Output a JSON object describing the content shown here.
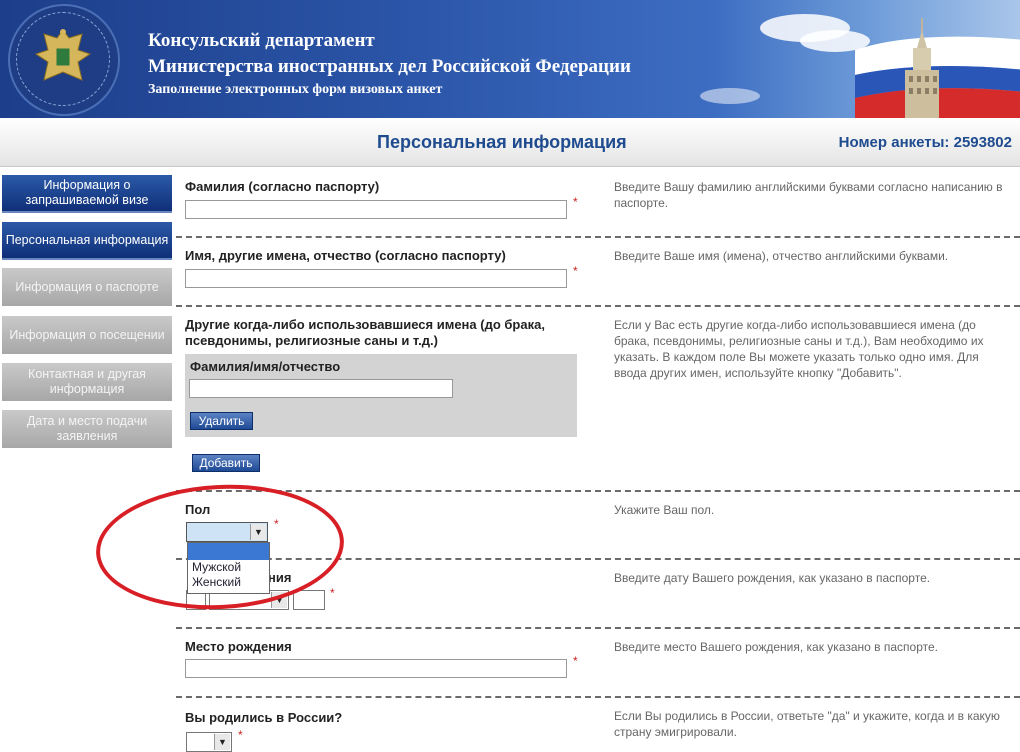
{
  "banner": {
    "title_line1": "Консульский департамент",
    "title_line2": "Министерства иностранных дел Российской Федерации",
    "subtitle": "Заполнение электронных форм визовых анкет"
  },
  "header": {
    "page_title": "Персональная информация",
    "anketa_number": "Номер анкеты: 2593802"
  },
  "nav": {
    "items": [
      {
        "label": "Информация о запрашиваемой визе",
        "state": "active"
      },
      {
        "label": "Персональная информация",
        "state": "active"
      },
      {
        "label": "Информация о паспорте",
        "state": "inactive"
      },
      {
        "label": "Информация о посещении",
        "state": "inactive"
      },
      {
        "label": "Контактная и другая информация",
        "state": "inactive"
      },
      {
        "label": "Дата и место подачи заявления",
        "state": "inactive"
      }
    ]
  },
  "form": {
    "surname": {
      "label": "Фамилия (согласно паспорту)",
      "value": "",
      "help": "Введите Вашу фамилию английскими буквами согласно написанию в паспорте."
    },
    "given_names": {
      "label": "Имя, другие имена, отчество (согласно паспорту)",
      "value": "",
      "help": "Введите Ваше имя (имена), отчество английскими буквами."
    },
    "other_names": {
      "label": "Другие когда-либо использовавшиеся имена (до брака, псевдонимы, религиозные саны и т.д.)",
      "sublabel": "Фамилия/имя/отчество",
      "value": "",
      "delete_button": "Удалить",
      "add_button": "Добавить",
      "help": "Если у Вас есть другие когда-либо использовавшиеся имена (до брака, псевдонимы, религиозные саны и т.д.), Вам необходимо их указать. В каждом поле Вы можете указать только одно имя. Для ввода других имен, используйте кнопку \"Добавить\"."
    },
    "sex": {
      "label": "Пол",
      "selected": "",
      "options": [
        "",
        "Мужской",
        "Женский"
      ],
      "help": "Укажите Ваш пол."
    },
    "birth_date": {
      "label_partial": "ния",
      "help": "Введите дату Вашего рождения, как указано в паспорте."
    },
    "birth_place": {
      "label": "Место рождения",
      "value": "",
      "help": "Введите место Вашего рождения, как указано в паспорте."
    },
    "born_in_russia": {
      "label": "Вы родились в России?",
      "help": "Если Вы родились в России, ответьте \"да\" и укажите, когда и в какую страну эмигрировали."
    },
    "required_mark": "*"
  },
  "colors": {
    "nav_active": "#1a3f8c",
    "nav_inactive": "#b5b5b5",
    "title_blue": "#1f4b8f",
    "annotation_red": "#d81f26"
  }
}
